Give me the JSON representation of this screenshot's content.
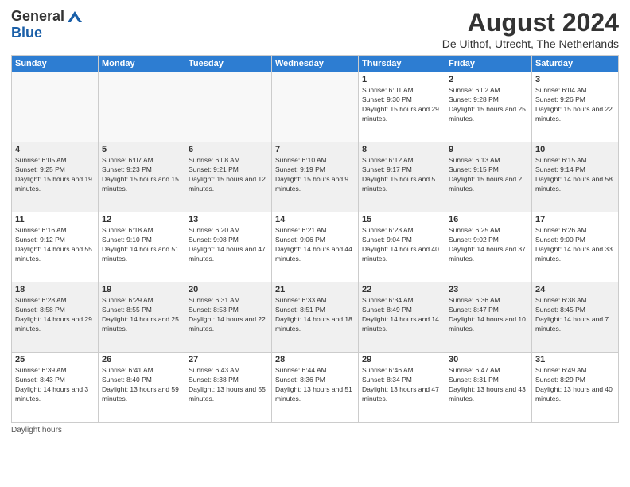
{
  "logo": {
    "general": "General",
    "blue": "Blue"
  },
  "header": {
    "month": "August 2024",
    "location": "De Uithof, Utrecht, The Netherlands"
  },
  "weekdays": [
    "Sunday",
    "Monday",
    "Tuesday",
    "Wednesday",
    "Thursday",
    "Friday",
    "Saturday"
  ],
  "weeks": [
    [
      {
        "day": "",
        "empty": true
      },
      {
        "day": "",
        "empty": true
      },
      {
        "day": "",
        "empty": true
      },
      {
        "day": "",
        "empty": true
      },
      {
        "day": "1",
        "sunrise": "6:01 AM",
        "sunset": "9:30 PM",
        "daylight": "15 hours and 29 minutes."
      },
      {
        "day": "2",
        "sunrise": "6:02 AM",
        "sunset": "9:28 PM",
        "daylight": "15 hours and 25 minutes."
      },
      {
        "day": "3",
        "sunrise": "6:04 AM",
        "sunset": "9:26 PM",
        "daylight": "15 hours and 22 minutes."
      }
    ],
    [
      {
        "day": "4",
        "sunrise": "6:05 AM",
        "sunset": "9:25 PM",
        "daylight": "15 hours and 19 minutes."
      },
      {
        "day": "5",
        "sunrise": "6:07 AM",
        "sunset": "9:23 PM",
        "daylight": "15 hours and 15 minutes."
      },
      {
        "day": "6",
        "sunrise": "6:08 AM",
        "sunset": "9:21 PM",
        "daylight": "15 hours and 12 minutes."
      },
      {
        "day": "7",
        "sunrise": "6:10 AM",
        "sunset": "9:19 PM",
        "daylight": "15 hours and 9 minutes."
      },
      {
        "day": "8",
        "sunrise": "6:12 AM",
        "sunset": "9:17 PM",
        "daylight": "15 hours and 5 minutes."
      },
      {
        "day": "9",
        "sunrise": "6:13 AM",
        "sunset": "9:15 PM",
        "daylight": "15 hours and 2 minutes."
      },
      {
        "day": "10",
        "sunrise": "6:15 AM",
        "sunset": "9:14 PM",
        "daylight": "14 hours and 58 minutes."
      }
    ],
    [
      {
        "day": "11",
        "sunrise": "6:16 AM",
        "sunset": "9:12 PM",
        "daylight": "14 hours and 55 minutes."
      },
      {
        "day": "12",
        "sunrise": "6:18 AM",
        "sunset": "9:10 PM",
        "daylight": "14 hours and 51 minutes."
      },
      {
        "day": "13",
        "sunrise": "6:20 AM",
        "sunset": "9:08 PM",
        "daylight": "14 hours and 47 minutes."
      },
      {
        "day": "14",
        "sunrise": "6:21 AM",
        "sunset": "9:06 PM",
        "daylight": "14 hours and 44 minutes."
      },
      {
        "day": "15",
        "sunrise": "6:23 AM",
        "sunset": "9:04 PM",
        "daylight": "14 hours and 40 minutes."
      },
      {
        "day": "16",
        "sunrise": "6:25 AM",
        "sunset": "9:02 PM",
        "daylight": "14 hours and 37 minutes."
      },
      {
        "day": "17",
        "sunrise": "6:26 AM",
        "sunset": "9:00 PM",
        "daylight": "14 hours and 33 minutes."
      }
    ],
    [
      {
        "day": "18",
        "sunrise": "6:28 AM",
        "sunset": "8:58 PM",
        "daylight": "14 hours and 29 minutes."
      },
      {
        "day": "19",
        "sunrise": "6:29 AM",
        "sunset": "8:55 PM",
        "daylight": "14 hours and 25 minutes."
      },
      {
        "day": "20",
        "sunrise": "6:31 AM",
        "sunset": "8:53 PM",
        "daylight": "14 hours and 22 minutes."
      },
      {
        "day": "21",
        "sunrise": "6:33 AM",
        "sunset": "8:51 PM",
        "daylight": "14 hours and 18 minutes."
      },
      {
        "day": "22",
        "sunrise": "6:34 AM",
        "sunset": "8:49 PM",
        "daylight": "14 hours and 14 minutes."
      },
      {
        "day": "23",
        "sunrise": "6:36 AM",
        "sunset": "8:47 PM",
        "daylight": "14 hours and 10 minutes."
      },
      {
        "day": "24",
        "sunrise": "6:38 AM",
        "sunset": "8:45 PM",
        "daylight": "14 hours and 7 minutes."
      }
    ],
    [
      {
        "day": "25",
        "sunrise": "6:39 AM",
        "sunset": "8:43 PM",
        "daylight": "14 hours and 3 minutes."
      },
      {
        "day": "26",
        "sunrise": "6:41 AM",
        "sunset": "8:40 PM",
        "daylight": "13 hours and 59 minutes."
      },
      {
        "day": "27",
        "sunrise": "6:43 AM",
        "sunset": "8:38 PM",
        "daylight": "13 hours and 55 minutes."
      },
      {
        "day": "28",
        "sunrise": "6:44 AM",
        "sunset": "8:36 PM",
        "daylight": "13 hours and 51 minutes."
      },
      {
        "day": "29",
        "sunrise": "6:46 AM",
        "sunset": "8:34 PM",
        "daylight": "13 hours and 47 minutes."
      },
      {
        "day": "30",
        "sunrise": "6:47 AM",
        "sunset": "8:31 PM",
        "daylight": "13 hours and 43 minutes."
      },
      {
        "day": "31",
        "sunrise": "6:49 AM",
        "sunset": "8:29 PM",
        "daylight": "13 hours and 40 minutes."
      }
    ]
  ],
  "footer": {
    "note": "Daylight hours"
  }
}
